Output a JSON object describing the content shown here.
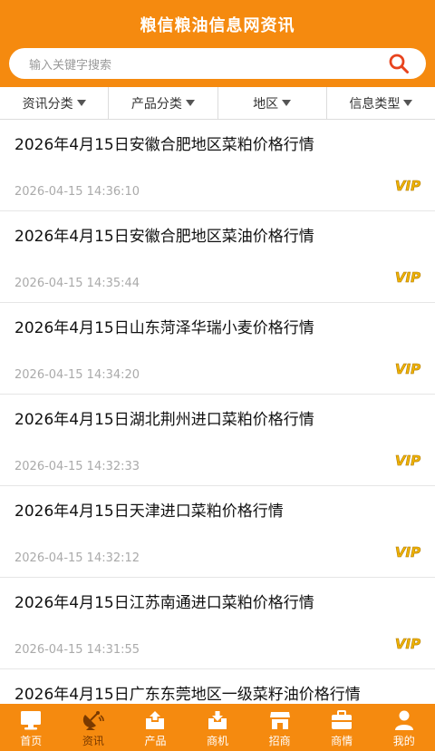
{
  "header": {
    "title": "粮信粮油信息网资讯"
  },
  "search": {
    "placeholder": "输入关键字搜索"
  },
  "filters": [
    {
      "label": "资讯分类"
    },
    {
      "label": "产品分类"
    },
    {
      "label": "地区"
    },
    {
      "label": "信息类型"
    }
  ],
  "articles": [
    {
      "title": "2026年4月15日安徽合肥地区菜粕价格行情",
      "time": "2026-04-15 14:36:10",
      "badge": "VIP"
    },
    {
      "title": "2026年4月15日安徽合肥地区菜油价格行情",
      "time": "2026-04-15 14:35:44",
      "badge": "VIP"
    },
    {
      "title": "2026年4月15日山东菏泽华瑞小麦价格行情",
      "time": "2026-04-15 14:34:20",
      "badge": "VIP"
    },
    {
      "title": "2026年4月15日湖北荆州进口菜粕价格行情",
      "time": "2026-04-15 14:32:33",
      "badge": "VIP"
    },
    {
      "title": "2026年4月15日天津进口菜粕价格行情",
      "time": "2026-04-15 14:32:12",
      "badge": "VIP"
    },
    {
      "title": "2026年4月15日江苏南通进口菜粕价格行情",
      "time": "2026-04-15 14:31:55",
      "badge": "VIP"
    },
    {
      "title": "2026年4月15日广东东莞地区一级菜籽油价格行情",
      "time": "",
      "badge": ""
    }
  ],
  "tabbar": [
    {
      "label": "首页",
      "icon": "monitor-icon"
    },
    {
      "label": "资讯",
      "icon": "satellite-dish-icon",
      "active": true
    },
    {
      "label": "产品",
      "icon": "upload-box-icon"
    },
    {
      "label": "商机",
      "icon": "download-box-icon"
    },
    {
      "label": "招商",
      "icon": "storefront-icon"
    },
    {
      "label": "商情",
      "icon": "briefcase-icon"
    },
    {
      "label": "我的",
      "icon": "user-icon"
    }
  ],
  "colors": {
    "brand": "#f58a0f",
    "vip": "#f0b400"
  }
}
